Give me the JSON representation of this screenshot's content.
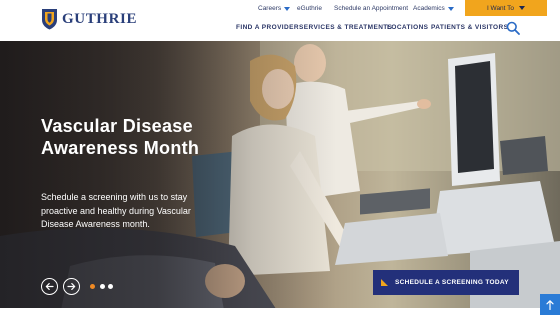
{
  "brand": {
    "name": "GUTHRIE",
    "colors": {
      "navy": "#2a3f7a",
      "gold": "#f1a51d",
      "cta": "#23307a"
    }
  },
  "utility_nav": {
    "careers": "Careers",
    "eguthrie": "eGuthrie",
    "schedule": "Schedule an Appointment",
    "academics": "Academics",
    "i_want_to": "I Want To"
  },
  "main_nav": {
    "find_provider": "FIND A PROVIDER",
    "services": "SERVICES & TREATMENTS",
    "locations": "LOCATIONS",
    "patients": "PATIENTS & VISITORS"
  },
  "hero": {
    "title": "Vascular Disease Awareness Month",
    "subtitle": "Schedule a screening with us to stay proactive and healthy during Vascular Disease Awareness month.",
    "cta": "SCHEDULE A SCREENING TODAY",
    "slides": {
      "count": 3,
      "active": 1
    }
  },
  "icons": {
    "logo": "shield-logo-icon",
    "search": "search-icon",
    "prev": "arrow-left-icon",
    "next": "arrow-right-icon",
    "scroll_top": "arrow-up-icon"
  }
}
